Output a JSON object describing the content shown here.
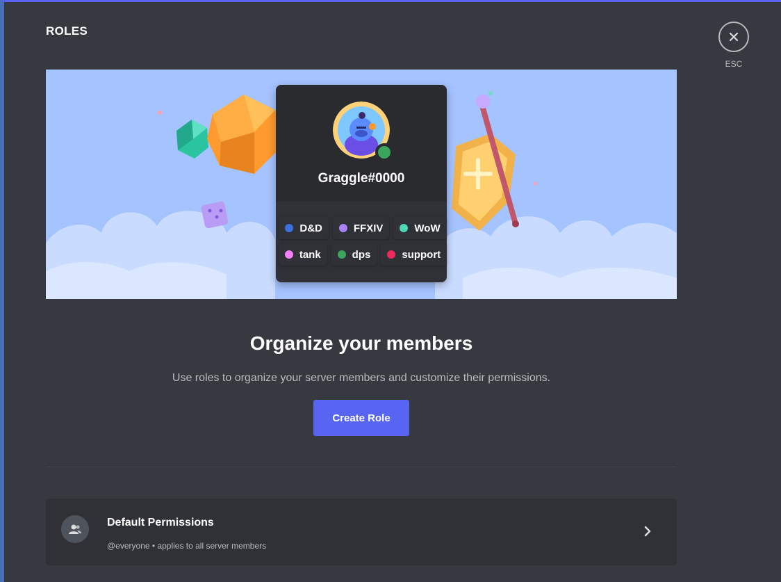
{
  "header": {
    "title": "ROLES",
    "close_label": "ESC",
    "close_icon": "close-icon"
  },
  "preview": {
    "username": "Graggle#0000",
    "avatar_icon": "avatar-illustration",
    "status_color": "#3ba55c",
    "roles": [
      [
        {
          "label": "D&D",
          "color": "#3e70dd"
        },
        {
          "label": "FFXIV",
          "color": "#a783fb"
        },
        {
          "label": "WoW",
          "color": "#4fd6b3"
        }
      ],
      [
        {
          "label": "tank",
          "color": "#f47fff"
        },
        {
          "label": "dps",
          "color": "#3ba55c"
        },
        {
          "label": "support",
          "color": "#ed2a5b"
        }
      ]
    ]
  },
  "main": {
    "heading": "Organize your members",
    "subtext": "Use roles to organize your server members and customize their permissions.",
    "create_button": "Create Role"
  },
  "default_permissions": {
    "title": "Default Permissions",
    "subtitle": "@everyone • applies to all server members",
    "icon": "members-icon",
    "chevron_icon": "chevron-right-icon"
  },
  "colors": {
    "accent": "#5865f2",
    "background": "#36393f",
    "banner": "#a5c3ff"
  }
}
